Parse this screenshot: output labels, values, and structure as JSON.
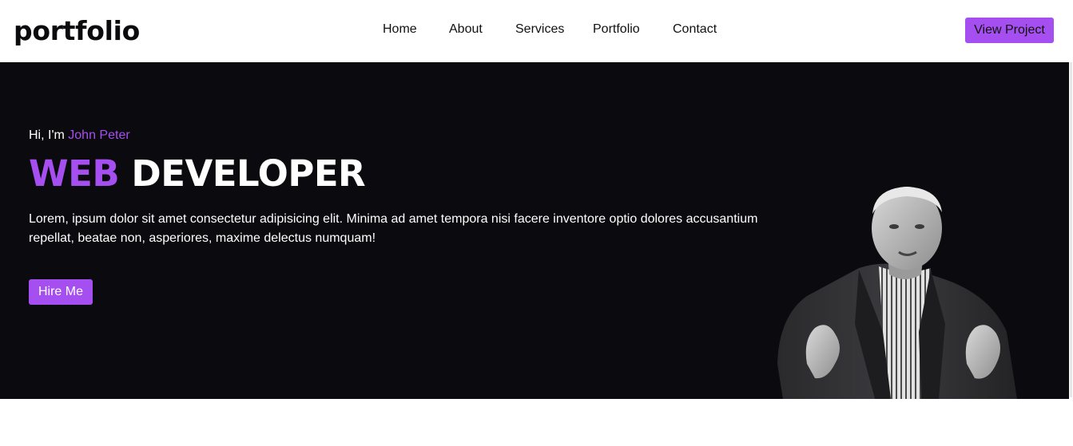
{
  "brand": {
    "logo": "portfolio"
  },
  "nav": {
    "items": [
      {
        "label": "Home"
      },
      {
        "label": "About"
      },
      {
        "label": "Services"
      },
      {
        "label": "Portfolio"
      },
      {
        "label": "Contact"
      }
    ],
    "cta_label": "View Project"
  },
  "hero": {
    "greeting_prefix": "Hi, I'm ",
    "name": "John Peter",
    "title_accent": "WEB",
    "title_rest": " DEVELOPER",
    "description": "Lorem, ipsum dolor sit amet consectetur adipisicing elit. Minima ad amet tempora nisi facere inventore optio dolores accusantium repellat, beatae non, asperiores, maxime delectus numquam!",
    "cta_label": "Hire Me"
  },
  "colors": {
    "accent": "#a64ff0",
    "hero_background": "#0b0a0e",
    "navbar_background": "#ffffff"
  }
}
